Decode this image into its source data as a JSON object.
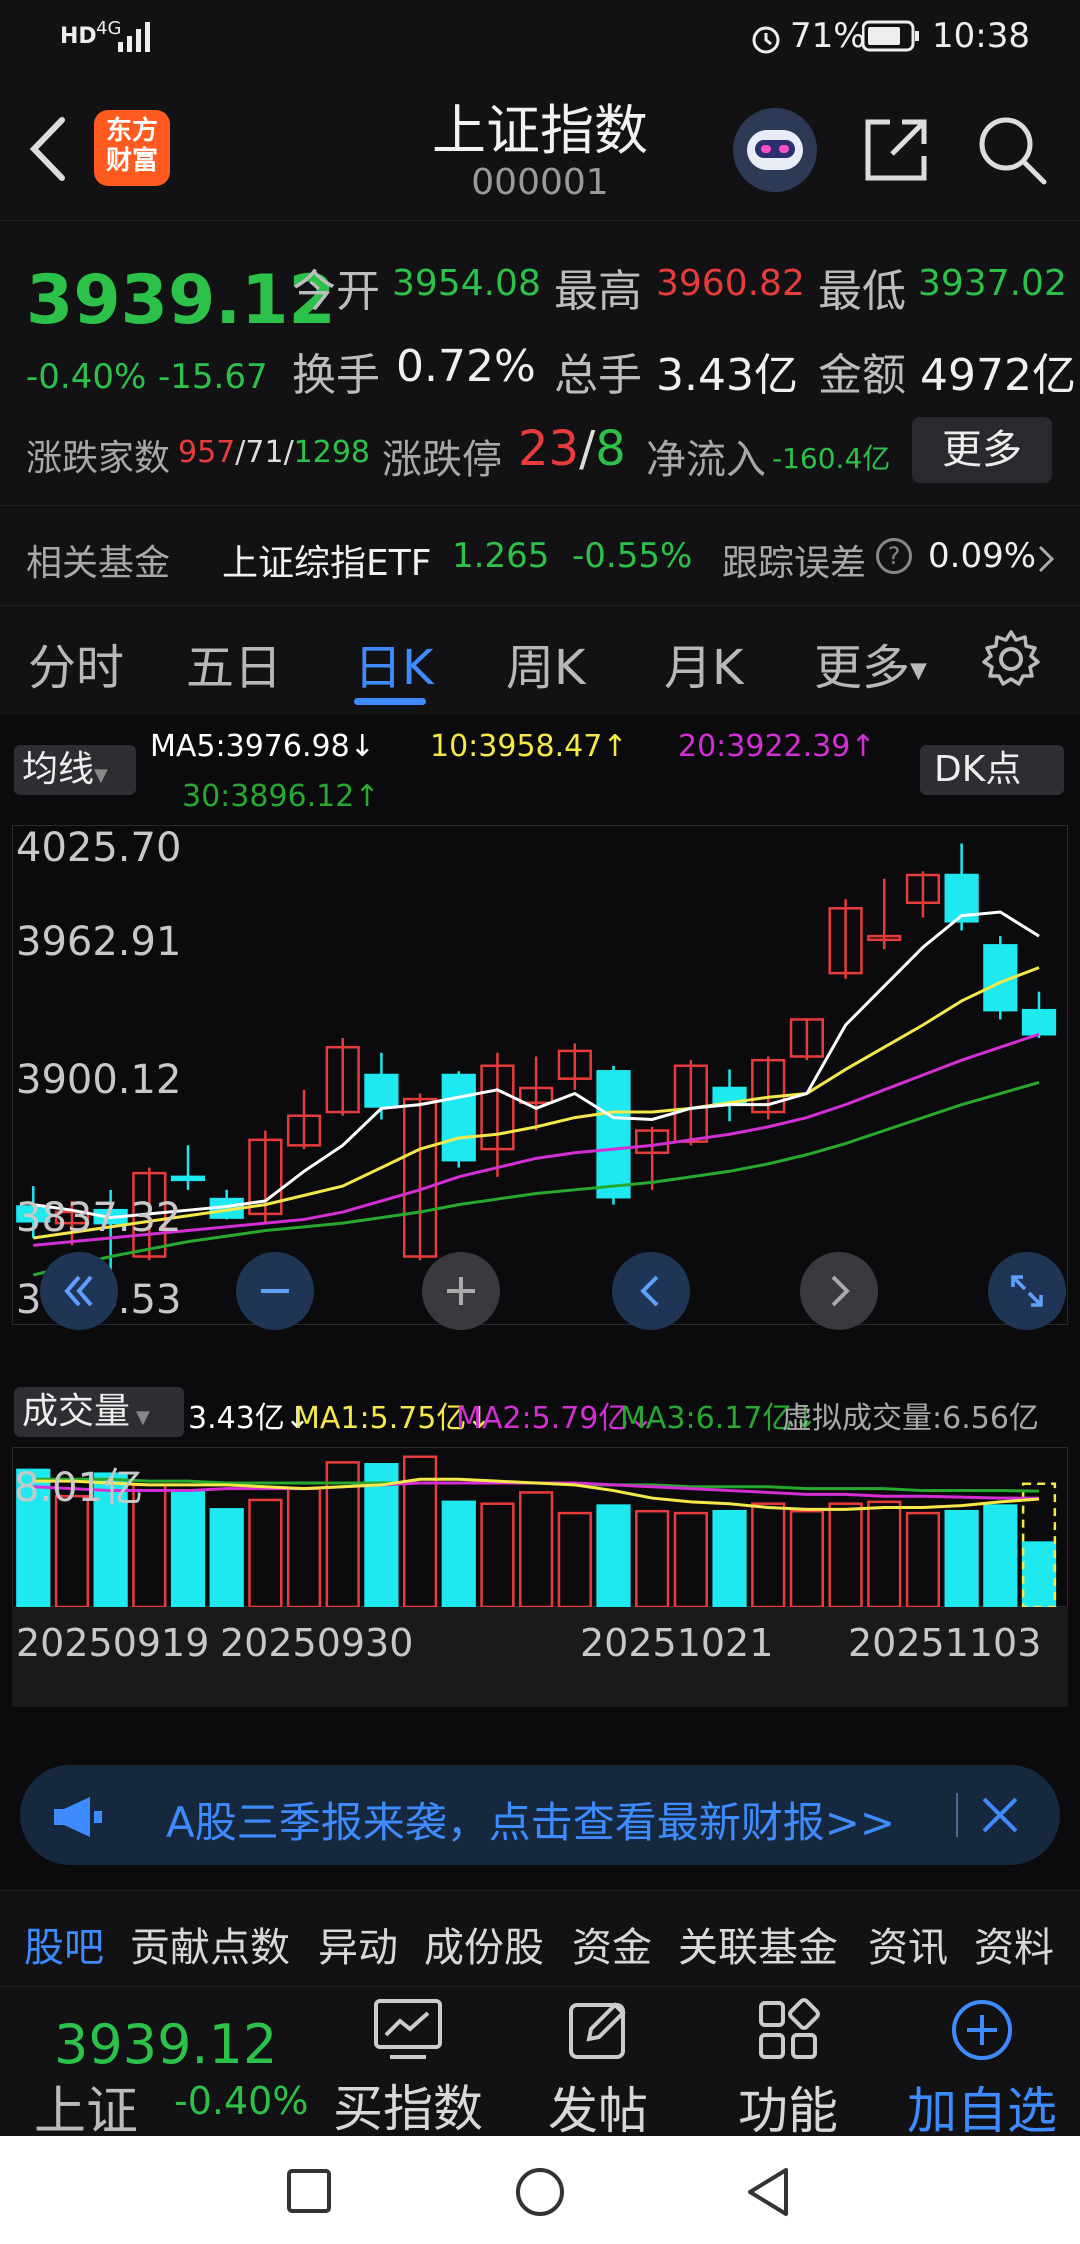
{
  "status": {
    "battery": "71%",
    "time": "10:38",
    "network": "4G"
  },
  "header": {
    "title": "上证指数",
    "code": "000001",
    "logo_line1": "东方",
    "logo_line2": "财富"
  },
  "quote": {
    "price": "3939.12",
    "change_pct": "-0.40%",
    "change_val": "-15.67",
    "open_label": "今开",
    "open": "3954.08",
    "high_label": "最高",
    "high": "3960.82",
    "low_label": "最低",
    "low": "3937.02",
    "turnover_label": "换手",
    "turnover": "0.72%",
    "volume_label": "总手",
    "volume": "3.43亿",
    "amount_label": "金额",
    "amount": "4972亿",
    "breadth_label": "涨跌家数",
    "breadth_up": "957",
    "breadth_flat": "71",
    "breadth_down": "1298",
    "limit_label": "涨跌停",
    "limit_up": "23",
    "limit_down": "8",
    "inflow_label": "净流入",
    "inflow": "-160.4亿",
    "more_button": "更多"
  },
  "fund": {
    "label": "相关基金",
    "name": "上证综指ETF",
    "price": "1.265",
    "change": "-0.55%",
    "track_label": "跟踪误差",
    "track": "0.09%"
  },
  "tabs": [
    "分时",
    "五日",
    "日K",
    "周K",
    "月K",
    "更多"
  ],
  "active_tab": 2,
  "ma_legend": {
    "selector": "均线",
    "ma5": "MA5:3976.98↓",
    "ma10": "10:3958.47↑",
    "ma20": "20:3922.39↑",
    "ma30": "30:3896.12↑",
    "dk_button": "DK点"
  },
  "price_axis": [
    "4025.70",
    "3962.91",
    "3900.12",
    "3837.32",
    "3774.53"
  ],
  "vol_legend": {
    "selector": "成交量",
    "vol": "3.43亿↓",
    "ma1": "MA1:5.75亿↓",
    "ma2": "MA2:5.79亿↓",
    "ma3": "MA3:6.17亿↓",
    "virtual": "虚拟成交量:6.56亿",
    "axis_max": "8.01亿"
  },
  "dates": [
    "20250919",
    "20250930",
    "20251021",
    "20251103"
  ],
  "colors": {
    "up": "#e83b3b",
    "down": "#1ee8f0",
    "ma5": "#ffffff",
    "ma10": "#f5e84a",
    "ma20": "#d42fd4",
    "ma30": "#27a82f",
    "accent": "#3d8bff"
  },
  "candles": [
    {
      "o": 3829,
      "h": 3840,
      "l": 3812,
      "c": 3821
    },
    {
      "o": 3820,
      "h": 3832,
      "l": 3808,
      "c": 3826
    },
    {
      "o": 3827,
      "h": 3838,
      "l": 3786,
      "c": 3820
    },
    {
      "o": 3802,
      "h": 3850,
      "l": 3800,
      "c": 3847
    },
    {
      "o": 3845,
      "h": 3862,
      "l": 3838,
      "c": 3844
    },
    {
      "o": 3833,
      "h": 3838,
      "l": 3822,
      "c": 3823
    },
    {
      "o": 3825,
      "h": 3870,
      "l": 3820,
      "c": 3865
    },
    {
      "o": 3862,
      "h": 3892,
      "l": 3860,
      "c": 3878
    },
    {
      "o": 3880,
      "h": 3920,
      "l": 3878,
      "c": 3915
    },
    {
      "o": 3900,
      "h": 3912,
      "l": 3876,
      "c": 3883
    },
    {
      "o": 3802,
      "h": 3890,
      "l": 3800,
      "c": 3887
    },
    {
      "o": 3900,
      "h": 3902,
      "l": 3850,
      "c": 3854
    },
    {
      "o": 3860,
      "h": 3912,
      "l": 3845,
      "c": 3905
    },
    {
      "o": 3885,
      "h": 3910,
      "l": 3870,
      "c": 3893
    },
    {
      "o": 3898,
      "h": 3917,
      "l": 3892,
      "c": 3913
    },
    {
      "o": 3902,
      "h": 3905,
      "l": 3830,
      "c": 3834
    },
    {
      "o": 3858,
      "h": 3872,
      "l": 3838,
      "c": 3870
    },
    {
      "o": 3864,
      "h": 3908,
      "l": 3862,
      "c": 3905
    },
    {
      "o": 3893,
      "h": 3903,
      "l": 3875,
      "c": 3884
    },
    {
      "o": 3880,
      "h": 3910,
      "l": 3876,
      "c": 3908
    },
    {
      "o": 3910,
      "h": 3930,
      "l": 3908,
      "c": 3930
    },
    {
      "o": 3955,
      "h": 3995,
      "l": 3952,
      "c": 3990
    },
    {
      "o": 3973,
      "h": 4006,
      "l": 3968,
      "c": 3975
    },
    {
      "o": 3993,
      "h": 4010,
      "l": 3985,
      "c": 4008
    },
    {
      "o": 4008,
      "h": 4025,
      "l": 3978,
      "c": 3983
    },
    {
      "o": 3970,
      "h": 3975,
      "l": 3930,
      "c": 3935
    },
    {
      "o": 3935,
      "h": 3945,
      "l": 3920,
      "c": 3922
    }
  ],
  "ma_series": {
    "ma5": [
      3830,
      3827,
      3823,
      3825,
      3827,
      3829,
      3832,
      3848,
      3862,
      3882,
      3884,
      3888,
      3892,
      3882,
      3890,
      3877,
      3876,
      3882,
      3884,
      3884,
      3890,
      3927,
      3948,
      3969,
      3986,
      3988,
      3975
    ],
    "ma10": [
      3812,
      3815,
      3818,
      3821,
      3824,
      3827,
      3830,
      3835,
      3840,
      3850,
      3860,
      3866,
      3868,
      3872,
      3877,
      3880,
      3880,
      3882,
      3885,
      3888,
      3890,
      3903,
      3915,
      3927,
      3940,
      3950,
      3958
    ],
    "ma20": [
      3808,
      3810,
      3812,
      3814,
      3816,
      3818,
      3820,
      3822,
      3826,
      3832,
      3838,
      3845,
      3850,
      3855,
      3858,
      3860,
      3862,
      3865,
      3868,
      3872,
      3877,
      3884,
      3892,
      3900,
      3908,
      3915,
      3922
    ],
    "ma30": [
      3792,
      3797,
      3802,
      3806,
      3810,
      3813,
      3816,
      3818,
      3820,
      3823,
      3826,
      3830,
      3833,
      3836,
      3838,
      3840,
      3842,
      3845,
      3848,
      3852,
      3857,
      3863,
      3870,
      3877,
      3884,
      3890,
      3896
    ]
  },
  "volumes": [
    7.3,
    5.9,
    7.1,
    6.5,
    6.2,
    5.2,
    5.7,
    6.3,
    7.7,
    7.6,
    8.0,
    5.6,
    5.5,
    6.1,
    5.0,
    5.4,
    5.1,
    5.0,
    5.1,
    5.5,
    5.1,
    5.5,
    5.6,
    5.0,
    5.1,
    5.4,
    3.43
  ],
  "vol_ma": {
    "ma1": [
      6.7,
      6.7,
      6.6,
      6.5,
      6.5,
      6.5,
      6.4,
      6.3,
      6.4,
      6.5,
      6.8,
      6.8,
      6.7,
      6.6,
      6.5,
      6.2,
      5.8,
      5.6,
      5.5,
      5.3,
      5.2,
      5.2,
      5.3,
      5.3,
      5.4,
      5.6,
      5.75
    ],
    "ma2": [
      6.4,
      6.3,
      6.2,
      6.2,
      6.2,
      6.3,
      6.3,
      6.3,
      6.4,
      6.5,
      6.6,
      6.6,
      6.6,
      6.6,
      6.6,
      6.5,
      6.4,
      6.3,
      6.2,
      6.1,
      6.0,
      6.0,
      5.9,
      5.9,
      5.85,
      5.8,
      5.79
    ],
    "ma3": [
      6.8,
      6.8,
      6.8,
      6.7,
      6.7,
      6.6,
      6.6,
      6.6,
      6.6,
      6.6,
      6.6,
      6.6,
      6.6,
      6.6,
      6.5,
      6.5,
      6.5,
      6.4,
      6.4,
      6.4,
      6.3,
      6.3,
      6.3,
      6.2,
      6.2,
      6.2,
      6.17
    ]
  },
  "banner": {
    "text": "A股三季报来袭，点击查看最新财报>>"
  },
  "bottom_tabs": [
    "股吧",
    "贡献点数",
    "异动",
    "成份股",
    "资金",
    "关联基金",
    "资讯",
    "资料"
  ],
  "bottom_nav": {
    "index_name": "上证",
    "index_price": "3939.12",
    "index_change": "-0.40%",
    "items": [
      "买指数",
      "发帖",
      "功能",
      "加自选"
    ]
  }
}
